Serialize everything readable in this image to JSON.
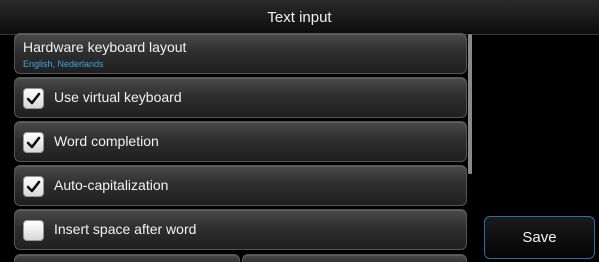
{
  "title_bar": {
    "title": "Text input"
  },
  "list": {
    "hardware_layout": {
      "title": "Hardware keyboard layout",
      "value": "English, Nederlands"
    },
    "options": [
      {
        "label": "Use virtual keyboard",
        "checked": true
      },
      {
        "label": "Word completion",
        "checked": true
      },
      {
        "label": "Auto-capitalization",
        "checked": true
      },
      {
        "label": "Insert space after word",
        "checked": false
      }
    ]
  },
  "actions": {
    "save_label": "Save"
  },
  "colors": {
    "accent": "#3aa6e6",
    "button_border": "#2a6fa8",
    "background": "#000000"
  }
}
